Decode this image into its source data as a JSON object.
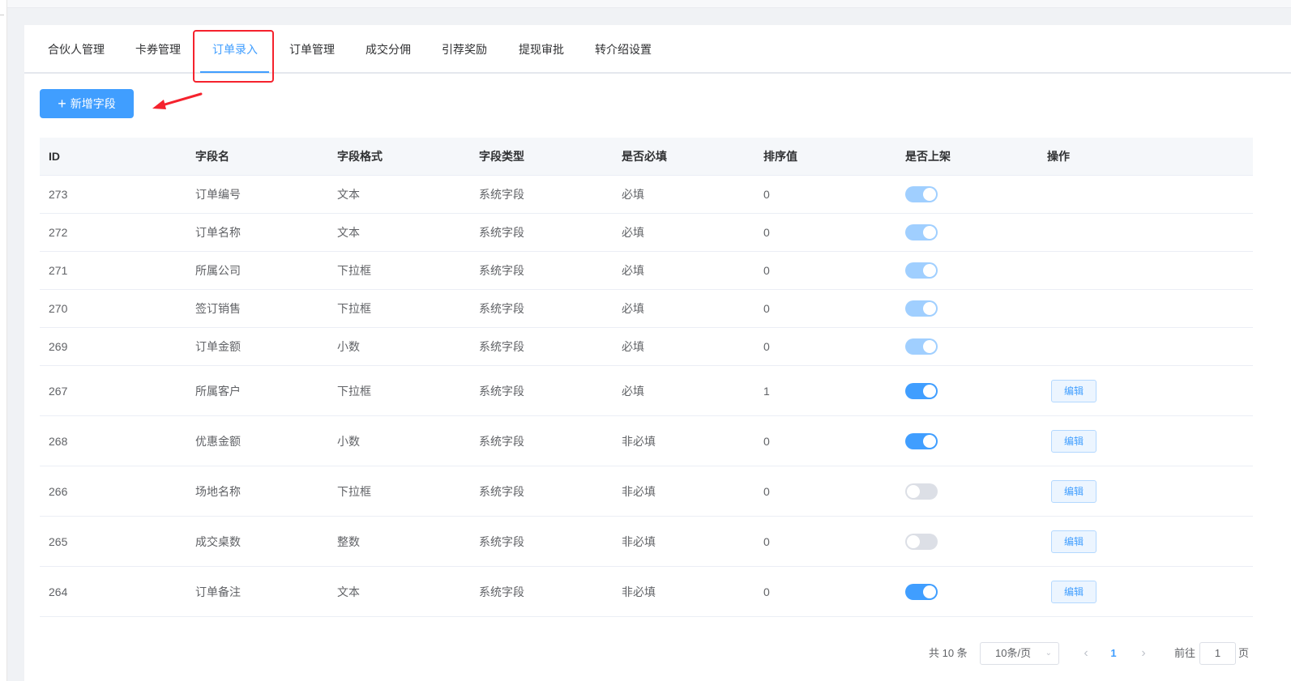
{
  "tabs": [
    {
      "label": "合伙人管理"
    },
    {
      "label": "卡券管理"
    },
    {
      "label": "订单录入"
    },
    {
      "label": "订单管理"
    },
    {
      "label": "成交分佣"
    },
    {
      "label": "引荐奖励"
    },
    {
      "label": "提现审批"
    },
    {
      "label": "转介绍设置"
    }
  ],
  "active_tab": "订单录入",
  "toolbar": {
    "add_label": "新增字段",
    "add_icon": "plus-icon"
  },
  "table": {
    "headers": [
      "ID",
      "字段名",
      "字段格式",
      "字段类型",
      "是否必填",
      "排序值",
      "是否上架",
      "操作"
    ],
    "rows": [
      {
        "id": "273",
        "name": "订单编号",
        "format": "文本",
        "type": "系统字段",
        "required": "必填",
        "sort": "0",
        "on_shelf": true,
        "switch_disabled": true,
        "action": ""
      },
      {
        "id": "272",
        "name": "订单名称",
        "format": "文本",
        "type": "系统字段",
        "required": "必填",
        "sort": "0",
        "on_shelf": true,
        "switch_disabled": true,
        "action": ""
      },
      {
        "id": "271",
        "name": "所属公司",
        "format": "下拉框",
        "type": "系统字段",
        "required": "必填",
        "sort": "0",
        "on_shelf": true,
        "switch_disabled": true,
        "action": ""
      },
      {
        "id": "270",
        "name": "签订销售",
        "format": "下拉框",
        "type": "系统字段",
        "required": "必填",
        "sort": "0",
        "on_shelf": true,
        "switch_disabled": true,
        "action": ""
      },
      {
        "id": "269",
        "name": "订单金额",
        "format": "小数",
        "type": "系统字段",
        "required": "必填",
        "sort": "0",
        "on_shelf": true,
        "switch_disabled": true,
        "action": ""
      },
      {
        "id": "267",
        "name": "所属客户",
        "format": "下拉框",
        "type": "系统字段",
        "required": "必填",
        "sort": "1",
        "on_shelf": true,
        "switch_disabled": false,
        "action": "编辑"
      },
      {
        "id": "268",
        "name": "优惠金额",
        "format": "小数",
        "type": "系统字段",
        "required": "非必填",
        "sort": "0",
        "on_shelf": true,
        "switch_disabled": false,
        "action": "编辑"
      },
      {
        "id": "266",
        "name": "场地名称",
        "format": "下拉框",
        "type": "系统字段",
        "required": "非必填",
        "sort": "0",
        "on_shelf": false,
        "switch_disabled": false,
        "action": "编辑"
      },
      {
        "id": "265",
        "name": "成交桌数",
        "format": "整数",
        "type": "系统字段",
        "required": "非必填",
        "sort": "0",
        "on_shelf": false,
        "switch_disabled": false,
        "action": "编辑"
      },
      {
        "id": "264",
        "name": "订单备注",
        "format": "文本",
        "type": "系统字段",
        "required": "非必填",
        "sort": "0",
        "on_shelf": true,
        "switch_disabled": false,
        "action": "编辑"
      }
    ]
  },
  "pagination": {
    "total_text": "共 10 条",
    "page_size": "10条/页",
    "current_page": "1",
    "goto_label": "前往",
    "goto_value": "1",
    "page_suffix": "页"
  },
  "colors": {
    "primary": "#409eff",
    "annotation": "#f5222d",
    "switch_off": "#dcdfe6"
  }
}
